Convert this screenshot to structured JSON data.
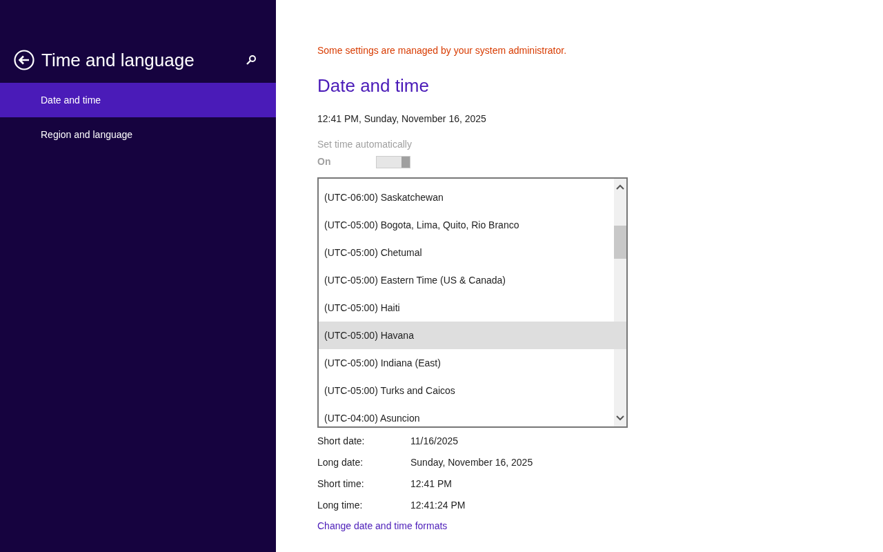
{
  "sidebar": {
    "title": "Time and language",
    "items": [
      {
        "label": "Date and time",
        "selected": true
      },
      {
        "label": "Region and language",
        "selected": false
      }
    ]
  },
  "admin_notice": "Some settings are managed by your system administrator.",
  "heading": "Date and time",
  "current_datetime": "12:41 PM, Sunday, November 16, 2025",
  "set_time_automatically": {
    "label": "Set time automatically",
    "state_text": "On",
    "on": true,
    "disabled": true
  },
  "time_zone_dropdown": {
    "options": [
      {
        "label": "(UTC-06:00) Saskatchewan",
        "selected": false
      },
      {
        "label": "(UTC-05:00) Bogota, Lima, Quito, Rio Branco",
        "selected": false
      },
      {
        "label": "(UTC-05:00) Chetumal",
        "selected": false
      },
      {
        "label": "(UTC-05:00) Eastern Time (US & Canada)",
        "selected": false
      },
      {
        "label": "(UTC-05:00) Haiti",
        "selected": false
      },
      {
        "label": "(UTC-05:00) Havana",
        "selected": true
      },
      {
        "label": "(UTC-05:00) Indiana (East)",
        "selected": false
      },
      {
        "label": "(UTC-05:00) Turks and Caicos",
        "selected": false
      },
      {
        "label": "(UTC-04:00) Asuncion",
        "selected": false
      }
    ]
  },
  "formats": [
    {
      "label": "Short date:",
      "value": "11/16/2025"
    },
    {
      "label": "Long date:",
      "value": "Sunday, November 16, 2025"
    },
    {
      "label": "Short time:",
      "value": "12:41 PM"
    },
    {
      "label": "Long time:",
      "value": "12:41:24 PM"
    }
  ],
  "formats_link": "Change date and time formats"
}
